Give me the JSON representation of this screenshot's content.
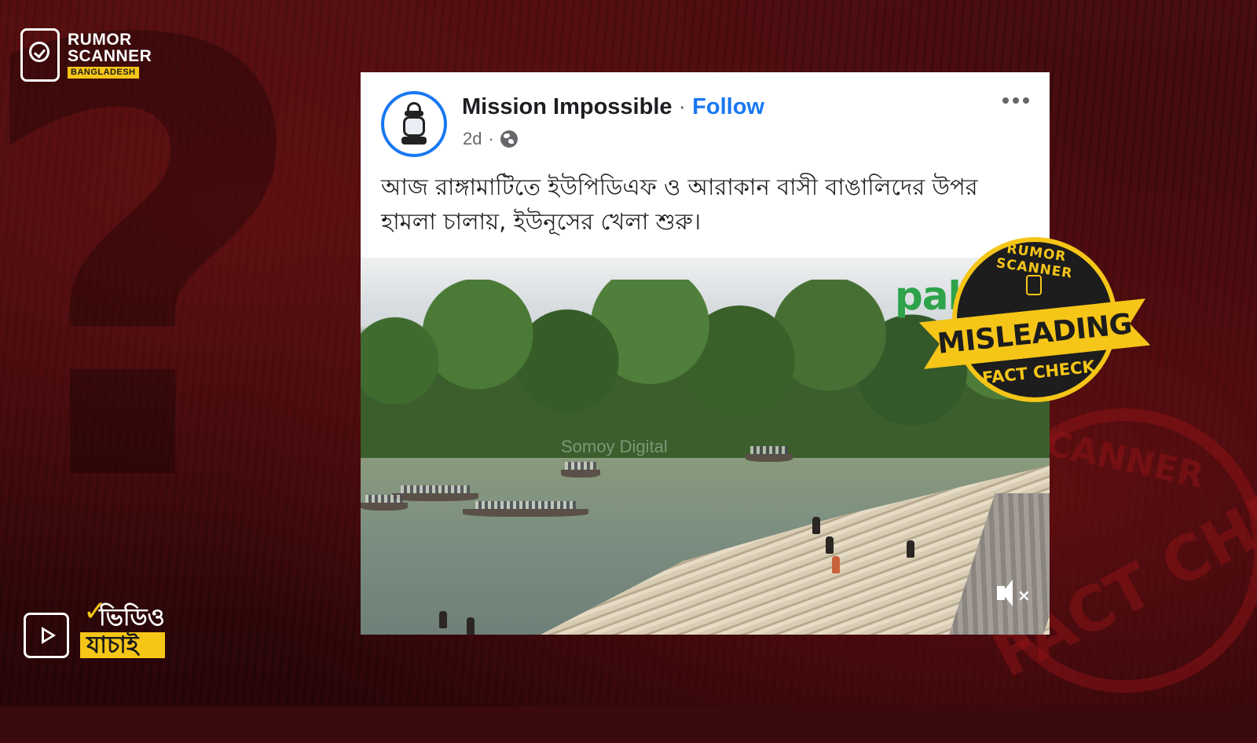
{
  "brand": {
    "line1": "RUMOR",
    "line2": "SCANNER",
    "line3": "BANGLADESH"
  },
  "video_yachai": {
    "line1": "ভিডিও",
    "line2": "যাচাই"
  },
  "post": {
    "page_name": "Mission Impossible",
    "separator": "·",
    "follow_label": "Follow",
    "time": "2d",
    "time_sep": "·",
    "text": "আজ রাঙ্গামাটিতে ইউপিডিএফ ও আরাকান বাসী বাঙালিদের উপর হামলা চালায়, ইউনূসের খেলা শুরু।",
    "video_watermark": "pal",
    "video_watermark2": "Somoy Digital"
  },
  "stamp": {
    "top_text": "RUMOR SCANNER",
    "ribbon_text": "MISLEADING",
    "bottom_text": "FACT CHECK"
  },
  "background_stamp": {
    "top_text": "CANNER",
    "main_text": "FACT CHECK"
  },
  "colors": {
    "accent": "#1877f2",
    "brand_yellow": "#f5c518",
    "background": "#3a0a0c"
  },
  "icons": {
    "logo": "phone-check-icon",
    "globe": "globe-icon",
    "more": "more-options-icon",
    "mute": "mute-icon",
    "play": "play-icon"
  }
}
